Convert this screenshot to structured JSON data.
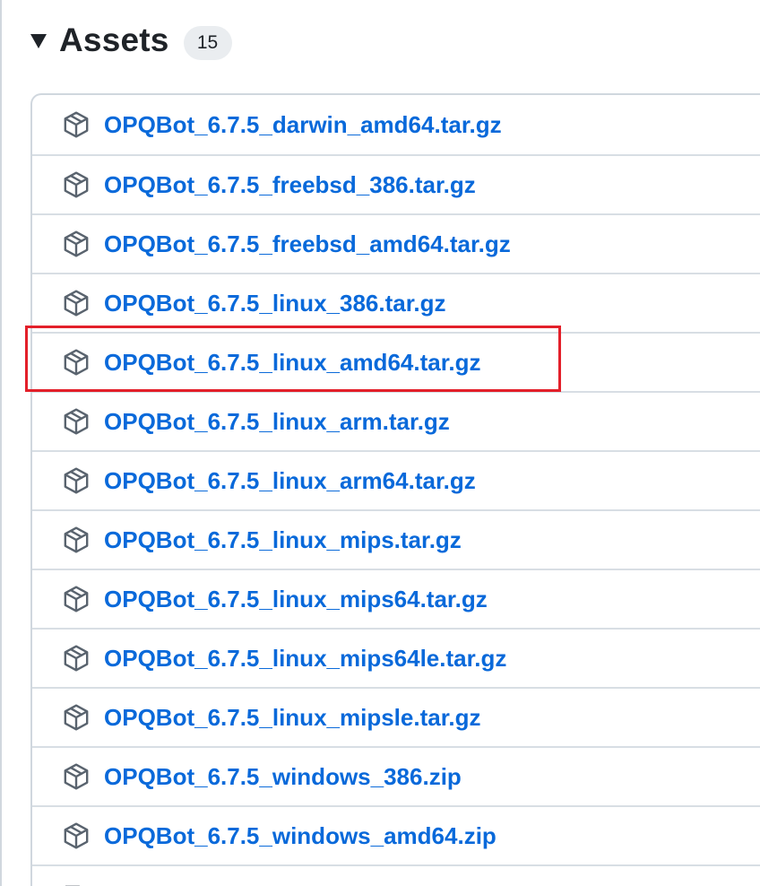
{
  "assets": {
    "title": "Assets",
    "count": "15",
    "items": [
      {
        "name": "OPQBot_6.7.5_darwin_amd64.tar.gz",
        "icon": "package-icon"
      },
      {
        "name": "OPQBot_6.7.5_freebsd_386.tar.gz",
        "icon": "package-icon"
      },
      {
        "name": "OPQBot_6.7.5_freebsd_amd64.tar.gz",
        "icon": "package-icon"
      },
      {
        "name": "OPQBot_6.7.5_linux_386.tar.gz",
        "icon": "package-icon"
      },
      {
        "name": "OPQBot_6.7.5_linux_amd64.tar.gz",
        "icon": "package-icon",
        "highlighted": true
      },
      {
        "name": "OPQBot_6.7.5_linux_arm.tar.gz",
        "icon": "package-icon"
      },
      {
        "name": "OPQBot_6.7.5_linux_arm64.tar.gz",
        "icon": "package-icon"
      },
      {
        "name": "OPQBot_6.7.5_linux_mips.tar.gz",
        "icon": "package-icon"
      },
      {
        "name": "OPQBot_6.7.5_linux_mips64.tar.gz",
        "icon": "package-icon"
      },
      {
        "name": "OPQBot_6.7.5_linux_mips64le.tar.gz",
        "icon": "package-icon"
      },
      {
        "name": "OPQBot_6.7.5_linux_mipsle.tar.gz",
        "icon": "package-icon"
      },
      {
        "name": "OPQBot_6.7.5_windows_386.zip",
        "icon": "package-icon"
      },
      {
        "name": "OPQBot_6.7.5_windows_amd64.zip",
        "icon": "package-icon"
      }
    ],
    "partial_item": {
      "icon": "file-zip-icon"
    }
  },
  "colors": {
    "link": "#0969da",
    "highlight": "#e3202a",
    "border": "#d0d7de",
    "text": "#1f2328",
    "badge_bg": "#eaedf0"
  }
}
